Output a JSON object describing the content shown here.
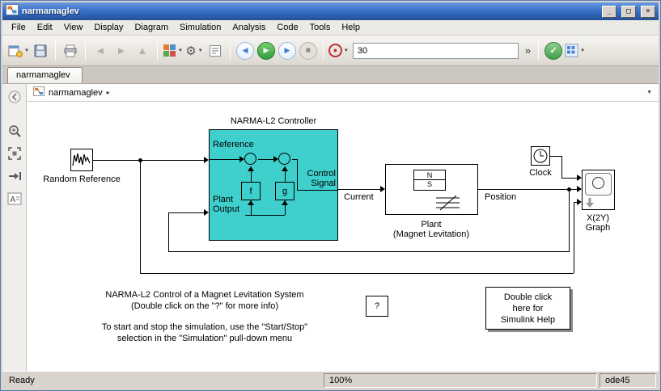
{
  "window": {
    "title": "narmamaglev",
    "minimize": "_",
    "maximize": "□",
    "close": "×"
  },
  "menubar": {
    "items": [
      "File",
      "Edit",
      "View",
      "Display",
      "Diagram",
      "Simulation",
      "Analysis",
      "Code",
      "Tools",
      "Help"
    ]
  },
  "toolbar": {
    "sim_stop_time": "30",
    "overflow_label": "»",
    "icons": {
      "caret": "▼",
      "back": "◄",
      "forward": "►",
      "up": "▲",
      "gear": "⚙",
      "step_back": "◀",
      "run": "▶",
      "step_forward": "▶",
      "stop": "■",
      "record": "●",
      "check": "✓"
    }
  },
  "tabs": {
    "active": "narmamaglev"
  },
  "breadcrumb": {
    "model": "narmamaglev",
    "arrow": "▸",
    "dropdown": "▼"
  },
  "sidebar": {
    "icons": [
      "hide-browser",
      "zoom-in",
      "fit-to-view",
      "navigate-forward",
      "annotations"
    ]
  },
  "diagram": {
    "random_reference": {
      "label": "Random Reference"
    },
    "controller": {
      "title": "NARMA-L2 Controller",
      "reference_label": "Reference",
      "plant_output_label_1": "Plant",
      "plant_output_label_2": "Output",
      "control_label_1": "Control",
      "control_label_2": "Signal",
      "f_label": "f",
      "g_label": "g"
    },
    "plant": {
      "name": "Plant",
      "subtitle": "(Magnet Levitation)",
      "north": "N",
      "south": "S"
    },
    "clock": {
      "label": "Clock"
    },
    "graph": {
      "label_1": "X(2Y)",
      "label_2": "Graph"
    },
    "signals": {
      "current": "Current",
      "position": "Position"
    },
    "question_block": {
      "label": "?"
    },
    "help_block": {
      "line1": "Double click",
      "line2": "here for",
      "line3": "Simulink Help"
    },
    "annotation1": {
      "line1": "NARMA-L2 Control of a Magnet Levitation System",
      "line2": "(Double click on the \"?\" for more info)"
    },
    "annotation2": {
      "line1": "To start and stop the simulation, use the \"Start/Stop\"",
      "line2": "selection in the \"Simulation\" pull-down menu"
    }
  },
  "statusbar": {
    "ready": "Ready",
    "zoom": "100%",
    "solver": "ode45"
  },
  "colors": {
    "controller_fill": "#3fd0cd",
    "titlebar_blue": "#3a72c8",
    "run_green": "#2f9e3f",
    "record_red": "#c23030",
    "check_green": "#3f9e4a"
  }
}
